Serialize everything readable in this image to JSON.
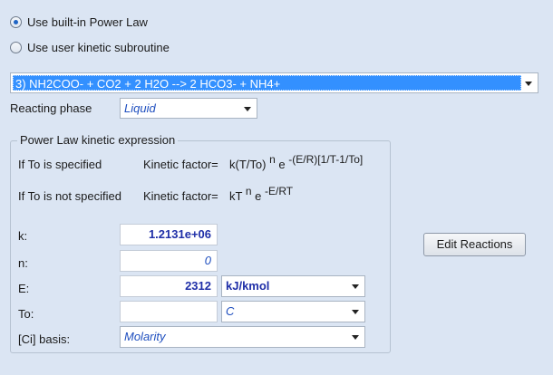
{
  "options": {
    "builtin_label": "Use built-in Power Law",
    "user_label": "Use user kinetic subroutine"
  },
  "reaction": {
    "selected": "3) NH2COO-  + CO2  + 2 H2O   -->  2 HCO3- + NH4+"
  },
  "phase": {
    "label": "Reacting phase",
    "value": "Liquid"
  },
  "kinetic": {
    "group_title": "Power Law kinetic expression",
    "to_specified": "If To is specified",
    "to_not_specified": "If To is not specified",
    "factor_label": "Kinetic factor=",
    "expr1_base": "k(T/To)",
    "expr1_n": "n",
    "expr1_e": "e",
    "expr1_exp": "-(E/R)[1/T-1/To]",
    "expr2_base": "kT",
    "expr2_n": "n",
    "expr2_e": "e",
    "expr2_exp": "-E/RT"
  },
  "params": {
    "k_label": "k:",
    "k_value": "1.2131e+06",
    "n_label": "n:",
    "n_value": "0",
    "e_label": "E:",
    "e_value": "2312",
    "e_unit": "kJ/kmol",
    "to_label": "To:",
    "to_value": "",
    "to_unit": "C",
    "ci_label": "[Ci] basis:",
    "ci_value": "Molarity"
  },
  "actions": {
    "edit_reactions": "Edit Reactions"
  }
}
